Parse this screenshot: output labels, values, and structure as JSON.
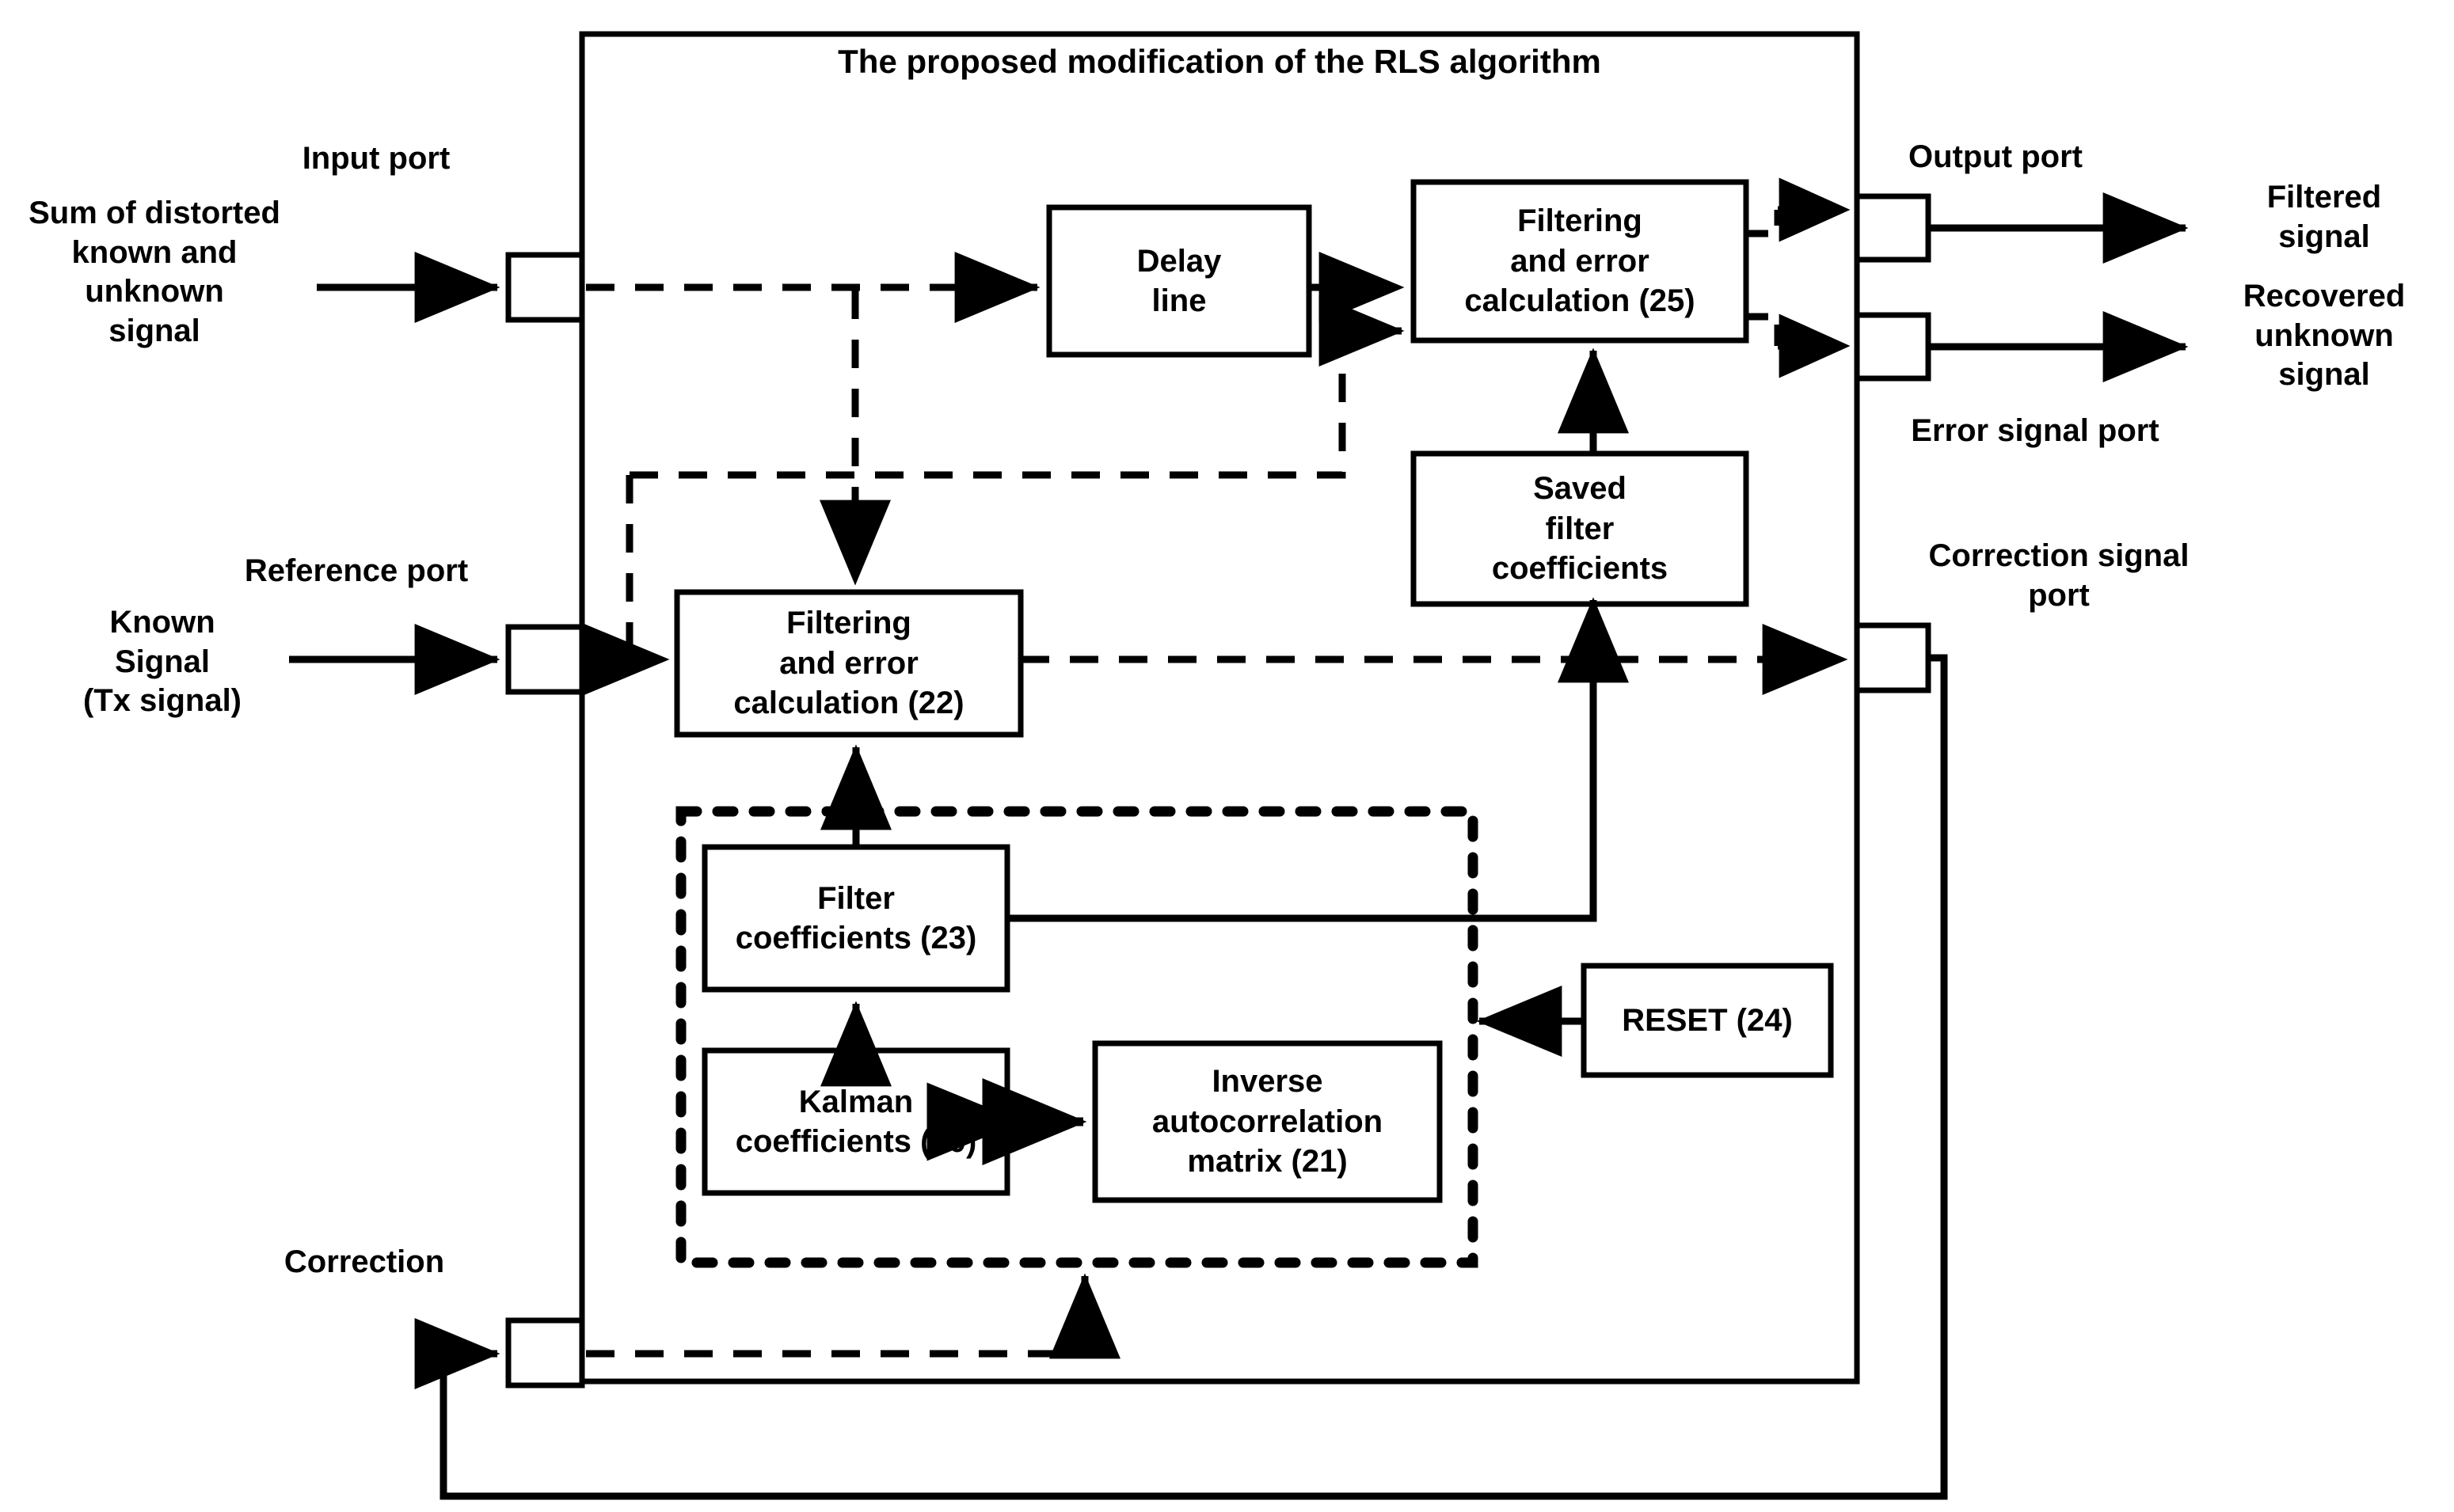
{
  "figure": {
    "type": "block-diagram",
    "title": "The proposed modification of the RLS algorithm",
    "background": "#ffffff",
    "line_color": "#000000"
  },
  "main_frame": {
    "title": "The proposed modification of the RLS algorithm"
  },
  "blocks": {
    "delay_line": {
      "label": "Delay\nline"
    },
    "filtering_25": {
      "label": "Filtering\nand error\ncalculation (25)"
    },
    "saved_filter": {
      "label": "Saved\nfilter\ncoefficients"
    },
    "filtering_22": {
      "label": "Filtering\nand error\ncalculation (22)"
    },
    "filter_coeffs_23": {
      "label": "Filter\ncoefficients (23)"
    },
    "kalman_coeffs_20": {
      "label": "Kalman\ncoefficients (20)"
    },
    "inverse_matrix_21": {
      "label": "Inverse\nautocorrelation\nmatrix (21)"
    },
    "reset_24": {
      "label": "RESET (24)"
    }
  },
  "ports": {
    "input": {
      "label": "Input port"
    },
    "reference": {
      "label": "Reference port"
    },
    "output": {
      "label": "Output port"
    },
    "error_signal": {
      "label": "Error signal port"
    },
    "correction_signal": {
      "label": "Correction signal\nport"
    },
    "correction": {
      "label": "Correction"
    }
  },
  "signals": {
    "input_left": {
      "label": "Sum of distorted\nknown and\nunknown\nsignal"
    },
    "reference_left": {
      "label": "Known\nSignal\n(Tx signal)"
    },
    "filtered_right": {
      "label": "Filtered\nsignal"
    },
    "recovered_right": {
      "label": "Recovered\nunknown\nsignal"
    }
  }
}
